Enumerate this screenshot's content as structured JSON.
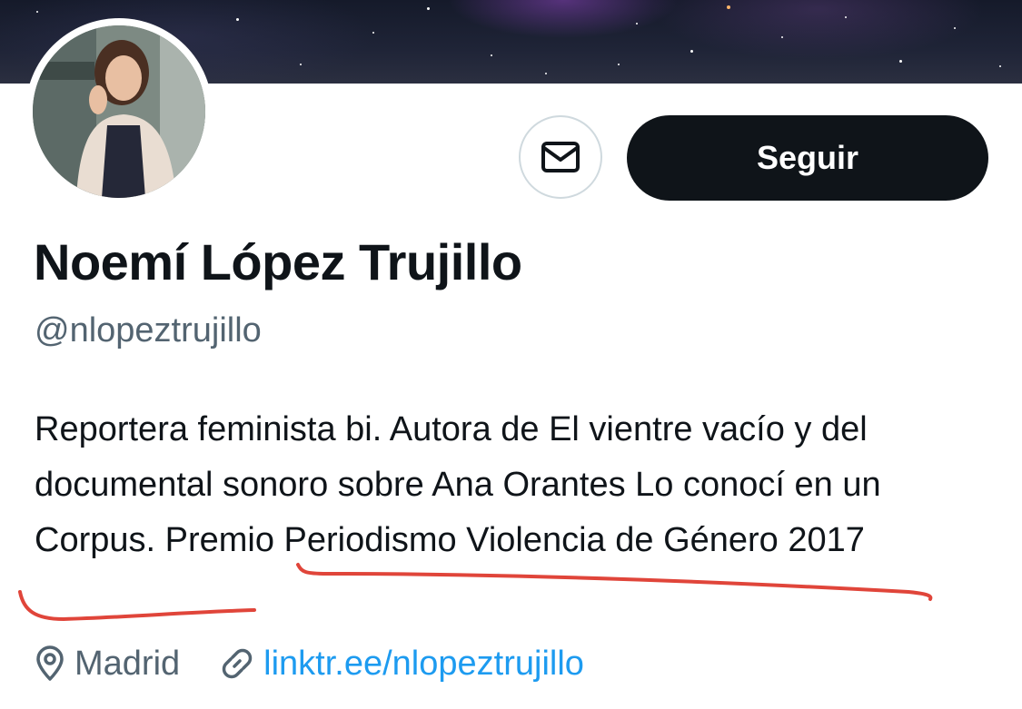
{
  "profile": {
    "display_name": "Noemí López Trujillo",
    "handle": "@nlopeztrujillo",
    "bio": "Reportera feminista bi. Autora de El vientre vacío y del documental sonoro sobre Ana Orantes Lo conocí en un Corpus. Premio Periodismo Violencia de Género 2017",
    "location": "Madrid",
    "website": "linktr.ee/nlopeztrujillo"
  },
  "actions": {
    "follow_label": "Seguir"
  },
  "icons": {
    "message": "envelope-icon",
    "location": "map-pin-icon",
    "link": "link-icon"
  },
  "colors": {
    "text_primary": "#0f1419",
    "text_secondary": "#536471",
    "link": "#1d9bf0",
    "follow_button_bg": "#0f1419",
    "annotation": "#e0453a"
  }
}
